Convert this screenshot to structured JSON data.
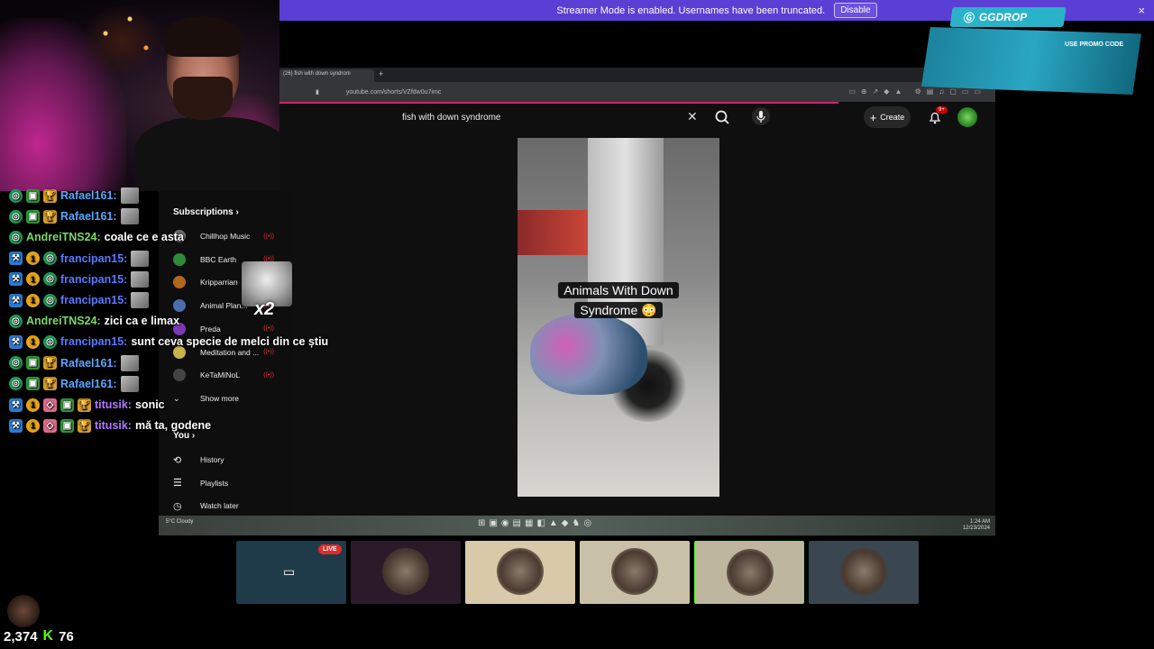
{
  "banner": {
    "text": "Streamer Mode is enabled. Usernames have been truncated.",
    "disable_label": "Disable",
    "close": "×"
  },
  "browser": {
    "tab_title": "(26) fish with down syndrom",
    "url": "youtube.com/shorts/VZfdw0u7imc",
    "search_value": "fish with down syndrome",
    "create_label": "Create",
    "notif_count": "9+"
  },
  "short": {
    "caption_line1": "Animals With Down",
    "caption_line2": "Syndrome 😳"
  },
  "sidebar": {
    "subscriptions_label": "Subscriptions",
    "channels": [
      {
        "name": "Chillhop Music",
        "color": "#6b6b6b"
      },
      {
        "name": "BBC Earth",
        "color": "#2f8a3c"
      },
      {
        "name": "Kripparrian",
        "color": "#b5651d"
      },
      {
        "name": "Animal Plan...",
        "color": "#4a6ea8"
      },
      {
        "name": "Preda",
        "color": "#7a3ab5"
      },
      {
        "name": "Meditation and ...",
        "color": "#c9b04a"
      },
      {
        "name": "KeTaMiNoL",
        "color": "#444444"
      }
    ],
    "show_more_label": "Show more",
    "you_label": "You",
    "you_items": [
      {
        "label": "History",
        "icon": "history-icon"
      },
      {
        "label": "Playlists",
        "icon": "playlists-icon"
      },
      {
        "label": "Watch later",
        "icon": "watch-later-icon"
      }
    ]
  },
  "chat": [
    {
      "user": "Rafael161:",
      "text": "",
      "color": "raf",
      "badges": [
        "cam",
        "gift",
        "sub"
      ],
      "emote": true
    },
    {
      "user": "Rafael161:",
      "text": "",
      "color": "raf",
      "badges": [
        "cam",
        "gift",
        "sub"
      ],
      "emote": true
    },
    {
      "user": "AndreiTNS24:",
      "text": "coale ce e asta",
      "color": "and",
      "badges": [
        "cam"
      ],
      "emote": false
    },
    {
      "user": "francipan15:",
      "text": "",
      "color": "fra",
      "badges": [
        "mod",
        "one",
        "cam"
      ],
      "emote": true
    },
    {
      "user": "francipan15:",
      "text": "",
      "color": "fra",
      "badges": [
        "mod",
        "one",
        "cam"
      ],
      "emote": true
    },
    {
      "user": "francipan15:",
      "text": "",
      "color": "fra",
      "badges": [
        "mod",
        "one",
        "cam"
      ],
      "emote": true
    },
    {
      "user": "AndreiTNS24:",
      "text": "zici ca e limax",
      "color": "and",
      "badges": [
        "cam"
      ],
      "emote": false
    },
    {
      "user": "francipan15:",
      "text": "sunt ceva specie de melci din ce știu",
      "color": "fra",
      "badges": [
        "mod",
        "one",
        "cam"
      ],
      "emote": false
    },
    {
      "user": "Rafael161:",
      "text": "",
      "color": "raf",
      "badges": [
        "cam",
        "gift",
        "sub"
      ],
      "emote": true
    },
    {
      "user": "Rafael161:",
      "text": "",
      "color": "raf",
      "badges": [
        "cam",
        "gift",
        "sub"
      ],
      "emote": true
    },
    {
      "user": "titusik:",
      "text": "sonic",
      "color": "tit",
      "badges": [
        "mod",
        "one",
        "pink",
        "gift",
        "sub"
      ],
      "emote": false
    },
    {
      "user": "titusik:",
      "text": "mă ta, godene",
      "color": "tit",
      "badges": [
        "mod",
        "one",
        "pink",
        "gift",
        "sub"
      ],
      "emote": false
    }
  ],
  "cat_multiplier": "x2",
  "overlay": {
    "brand": "GGDROP",
    "promo_text": "USE PROMO CODE"
  },
  "cards": [
    {
      "name": "card-video-chat",
      "live": "LIVE",
      "bg": "#1f3a48"
    },
    {
      "name": "card-avatar-2",
      "bg": "#2a1a2a"
    },
    {
      "name": "card-avatar-3",
      "bg": "#d8c9a8"
    },
    {
      "name": "card-avatar-4",
      "bg": "#c9c0a8"
    },
    {
      "name": "card-avatar-5",
      "bg": "#bfb6a0"
    },
    {
      "name": "card-avatar-6",
      "bg": "#3a4650"
    }
  ],
  "stats": {
    "viewers": "2,374",
    "followers": "76"
  },
  "taskbar": {
    "weather": "5°C Cloudy",
    "time": "1:24 AM",
    "date": "12/23/2024"
  }
}
